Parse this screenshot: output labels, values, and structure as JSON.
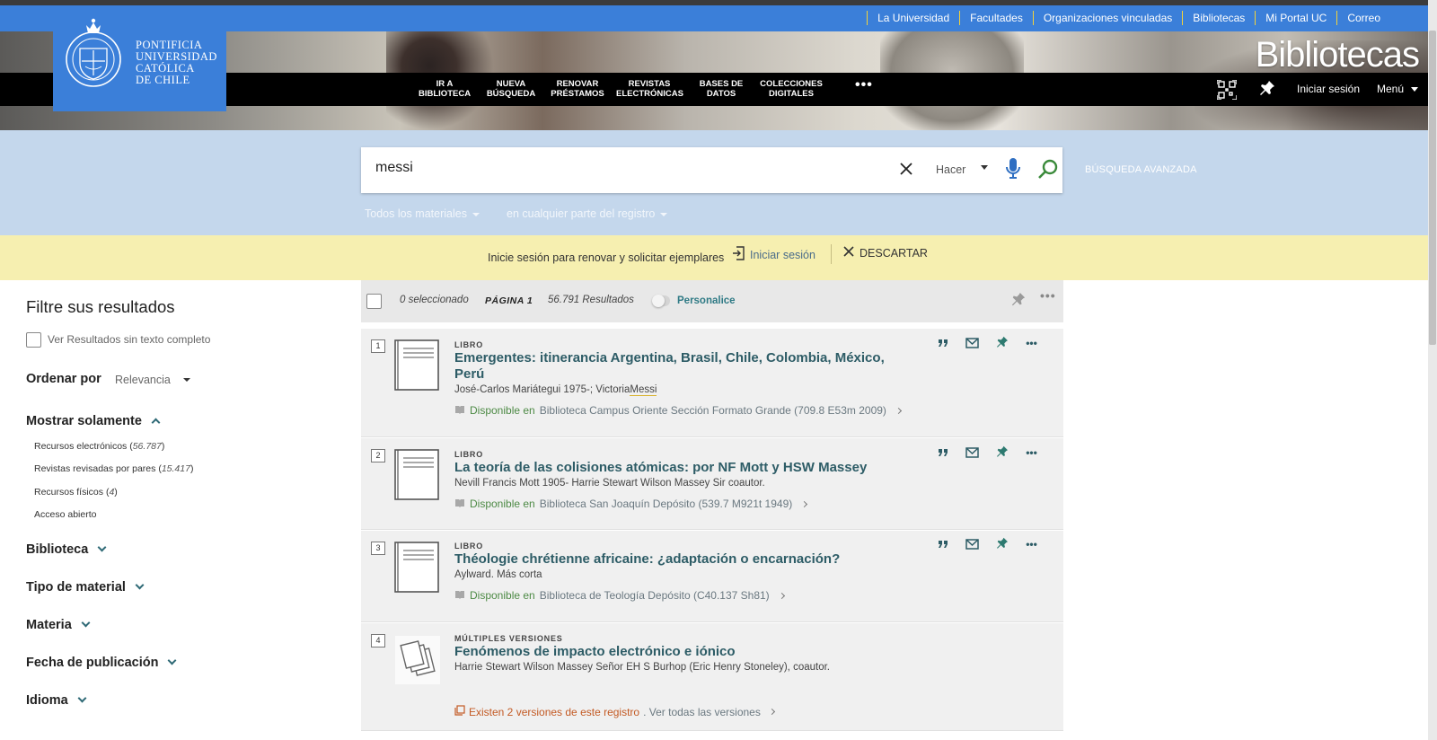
{
  "top_links": [
    "La Universidad",
    "Facultades",
    "Organizaciones vinculadas",
    "Bibliotecas",
    "Mi Portal UC",
    "Correo"
  ],
  "logo": {
    "lines": [
      "PONTIFICIA",
      "UNIVERSIDAD",
      "CATÓLICA",
      "DE CHILE"
    ]
  },
  "hero_title": "Bibliotecas",
  "nav": {
    "items": [
      {
        "l1": "IR A",
        "l2": "BIBLIOTECA"
      },
      {
        "l1": "NUEVA",
        "l2": "BÚSQUEDA"
      },
      {
        "l1": "RENOVAR",
        "l2": "PRÉSTAMOS"
      },
      {
        "l1": "REVISTAS",
        "l2": "ELECTRÓNICAS"
      },
      {
        "l1": "BASES DE",
        "l2": "DATOS"
      },
      {
        "l1": "COLECCIONES",
        "l2": "DIGITALES"
      }
    ],
    "more": "•••",
    "login": "Iniciar sesión",
    "menu": "Menú"
  },
  "search": {
    "query": "messi",
    "scope": "Hacer",
    "advanced": "BÚSQUEDA AVANZADA",
    "material_filter": "Todos los materiales",
    "field_filter": "en cualquier parte del registro"
  },
  "notice": {
    "text": "Inicie sesión para renovar y solicitar ejemplares",
    "login": "Iniciar sesión",
    "dismiss": "DESCARTAR"
  },
  "sidebar": {
    "title": "Filtre sus resultados",
    "fulltext": "Ver Resultados sin texto completo",
    "sort_label": "Ordenar por",
    "sort_value": "Relevancia",
    "show_only": "Mostrar solamente",
    "show_only_items": [
      {
        "label": "Recursos electrónicos",
        "count": "56.787"
      },
      {
        "label": "Revistas revisadas por pares",
        "count": "15.417"
      },
      {
        "label": "Recursos físicos",
        "count": "4"
      },
      {
        "label": "Acceso abierto",
        "count": ""
      }
    ],
    "facets": [
      "Biblioteca",
      "Tipo de material",
      "Materia",
      "Fecha de publicación",
      "Idioma"
    ]
  },
  "toolbar": {
    "selected": "0 seleccionado",
    "page": "PÁGINA 1",
    "count": "56.791 Resultados",
    "customize": "Personalice"
  },
  "results": [
    {
      "num": "1",
      "type": "LIBRO",
      "title": "Emergentes: itinerancia Argentina, Brasil, Chile, Colombia, México, Perú",
      "author_pre": "José-Carlos Mariátegui 1975-; Victoria",
      "author_hl": "Messi",
      "avail": "Disponible en",
      "location": "Biblioteca Campus Oriente Sección Formato Grande (709.8 E53m 2009)"
    },
    {
      "num": "2",
      "type": "LIBRO",
      "title": "La teoría de las colisiones atómicas: por NF Mott y HSW Massey",
      "author_pre": "Nevill Francis Mott 1905- Harrie Stewart Wilson Massey Sir coautor.",
      "author_hl": "",
      "avail": "Disponible en",
      "location": "Biblioteca San Joaquín Depósito (539.7 M921t 1949)"
    },
    {
      "num": "3",
      "type": "LIBRO",
      "title": "Théologie chrétienne africaine: ¿adaptación o encarnación?",
      "author_pre": "Aylward. Más corta",
      "author_hl": "",
      "avail": "Disponible en",
      "location": "Biblioteca de Teología Depósito (C40.137 Sh81)"
    },
    {
      "num": "4",
      "type": "MÚLTIPLES VERSIONES",
      "title": "Fenómenos de impacto electrónico e iónico",
      "author_pre": "Harrie Stewart Wilson Massey Señor EH S Burhop (Eric Henry Stoneley), coautor.",
      "author_hl": "",
      "versions_text": "Existen 2 versiones de este registro",
      "versions_link": "Ver todas las versiones"
    }
  ],
  "colors": {
    "brand_blue": "#3b7fd9",
    "search_zone": "#c4d7ec",
    "notice": "#f6efb0",
    "title_teal": "#2d5c66",
    "available_green": "#4d8a45",
    "versions_orange": "#c35a24"
  }
}
